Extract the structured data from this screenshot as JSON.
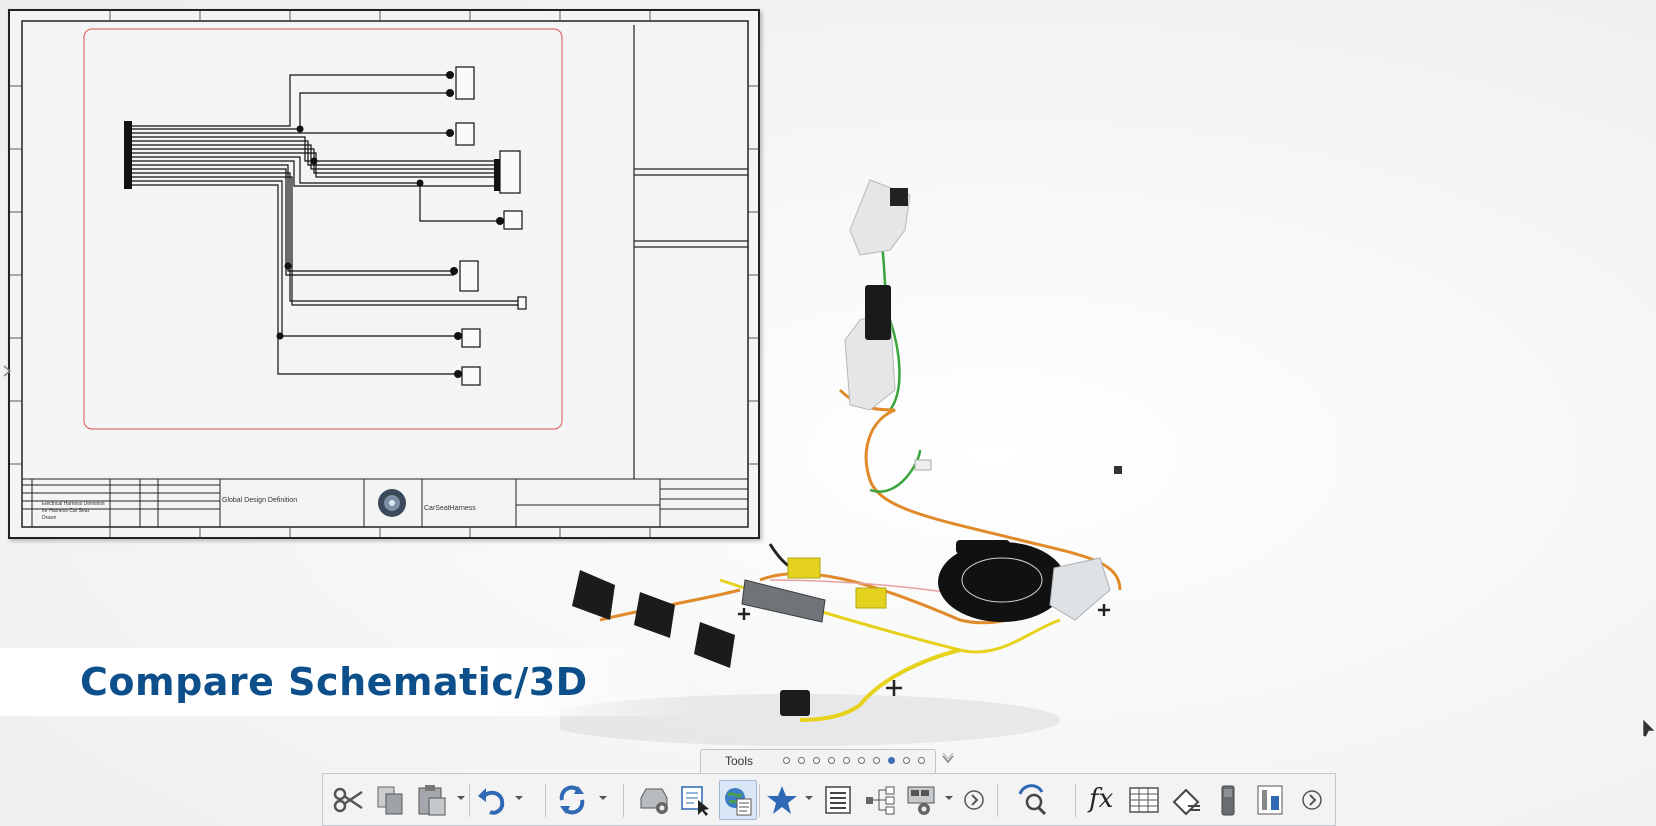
{
  "banner": {
    "title": "Compare Schematic/3D"
  },
  "sheet": {
    "title_block": {
      "design_name": "Global Design Definition",
      "harness_name": "CarSeatHarness",
      "description_lines": [
        "Electrical Harness Definition",
        "for Harness Car Seat"
      ],
      "drawn_label": "Drawn"
    }
  },
  "tools": {
    "label": "Tools",
    "page_count": 10,
    "active_page_index": 7
  },
  "toolbar": {
    "buttons": [
      {
        "name": "cut-button",
        "icon": "scissors-icon"
      },
      {
        "name": "copy-button",
        "icon": "copy-icon"
      },
      {
        "name": "paste-button",
        "icon": "paste-icon",
        "dropdown": true
      },
      {
        "name": "undo-button",
        "icon": "undo-icon",
        "dropdown": true
      },
      {
        "name": "update-button",
        "icon": "update-icon",
        "dropdown": true
      },
      {
        "name": "drive-settings-button",
        "icon": "drive-gear-icon"
      },
      {
        "name": "select-button",
        "icon": "select-cursor-icon"
      },
      {
        "name": "web-settings-button",
        "icon": "globe-sheet-icon",
        "active": true
      },
      {
        "name": "favorites-button",
        "icon": "star-icon",
        "dropdown": true
      },
      {
        "name": "properties-list-button",
        "icon": "list-icon"
      },
      {
        "name": "tree-button",
        "icon": "tree-icon"
      },
      {
        "name": "tools-options-button",
        "icon": "panel-gear-icon",
        "dropdown": true
      },
      {
        "name": "more-left-button",
        "icon": "chevron-right-icon"
      },
      {
        "name": "search-button",
        "icon": "search-icon"
      },
      {
        "name": "formula-button",
        "icon": "fx-icon",
        "label": "fx"
      },
      {
        "name": "table-button",
        "icon": "table-icon"
      },
      {
        "name": "measure-button",
        "icon": "measure-icon"
      },
      {
        "name": "battery-button",
        "icon": "battery-icon"
      },
      {
        "name": "parameters-button",
        "icon": "parameters-icon"
      },
      {
        "name": "more-right-button",
        "icon": "chevron-right-icon"
      }
    ]
  },
  "colors": {
    "banner_text": "#0d4f8b",
    "wire_orange": "#e08a2a",
    "wire_yellow": "#e6d21a",
    "wire_green": "#3aa53a",
    "border_red": "#d9534f"
  }
}
